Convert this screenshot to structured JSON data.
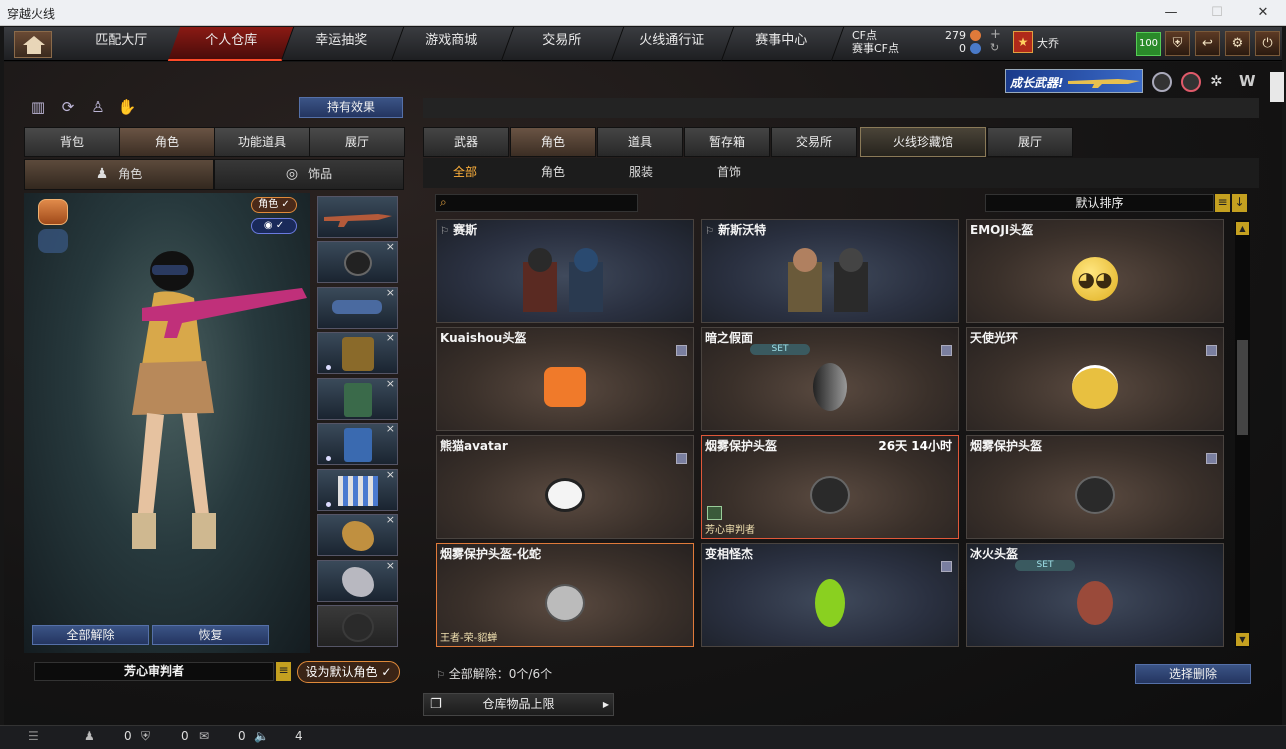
{
  "window": {
    "title": "穿越火线",
    "min": "—",
    "max": "☐",
    "close": "✕"
  },
  "nav": {
    "tabs": [
      "匹配大厅",
      "个人仓库",
      "幸运抽奖",
      "游戏商城",
      "交易所",
      "火线通行证",
      "赛事中心"
    ],
    "cf_label": "CF点",
    "cf_value": "279",
    "match_cf_label": "赛事CF点",
    "match_cf_value": "0",
    "user_name": "大乔",
    "level": "100"
  },
  "banner": {
    "text": "成长武器!"
  },
  "left": {
    "hold_effect": "持有效果",
    "tabs": [
      "背包",
      "角色",
      "功能道具",
      "展厅"
    ],
    "subtabs": [
      "角色",
      "饰品"
    ],
    "badge_role": "角色",
    "unequip_all": "全部解除",
    "restore": "恢复",
    "char_name": "芳心审判者",
    "set_default": "设为默认角色"
  },
  "right": {
    "tabs": [
      "武器",
      "角色",
      "道具",
      "暂存箱",
      "交易所",
      "火线珍藏馆",
      "展厅"
    ],
    "filters": [
      "全部",
      "角色",
      "服装",
      "首饰"
    ],
    "search_placeholder": "",
    "sort": "默认排序",
    "items": [
      {
        "name": "赛斯",
        "icon": "characters-pair"
      },
      {
        "name": "新斯沃特",
        "icon": "characters-pair"
      },
      {
        "name": "EMOJI头盔",
        "icon": "emoji-face"
      },
      {
        "name": "Kuaishou头盔",
        "icon": "orange-helmet"
      },
      {
        "name": "暗之假面",
        "icon": "dark-mask",
        "set": "SET"
      },
      {
        "name": "天使光环",
        "icon": "angel-halo"
      },
      {
        "name": "熊猫avatar",
        "icon": "panda-head"
      },
      {
        "name": "烟雾保护头盔",
        "icon": "smoke-helmet",
        "time": "26天 14小时",
        "label": "芳心审判者"
      },
      {
        "name": "烟雾保护头盔",
        "icon": "smoke-helmet"
      },
      {
        "name": "烟雾保护头盔-化蛇",
        "icon": "snake-helmet",
        "label": "王者-荣-貂蝉"
      },
      {
        "name": "变相怪杰",
        "icon": "green-mask"
      },
      {
        "name": "冰火头盔",
        "icon": "fire-ice-helmet",
        "set": "SET"
      }
    ],
    "unequip_status": "全部解除：0个/6个",
    "select_delete": "选择删除",
    "limit": "仓库物品上限"
  },
  "bottom": {
    "v1": "0",
    "v2": "0",
    "v3": "0",
    "v4": "4"
  }
}
